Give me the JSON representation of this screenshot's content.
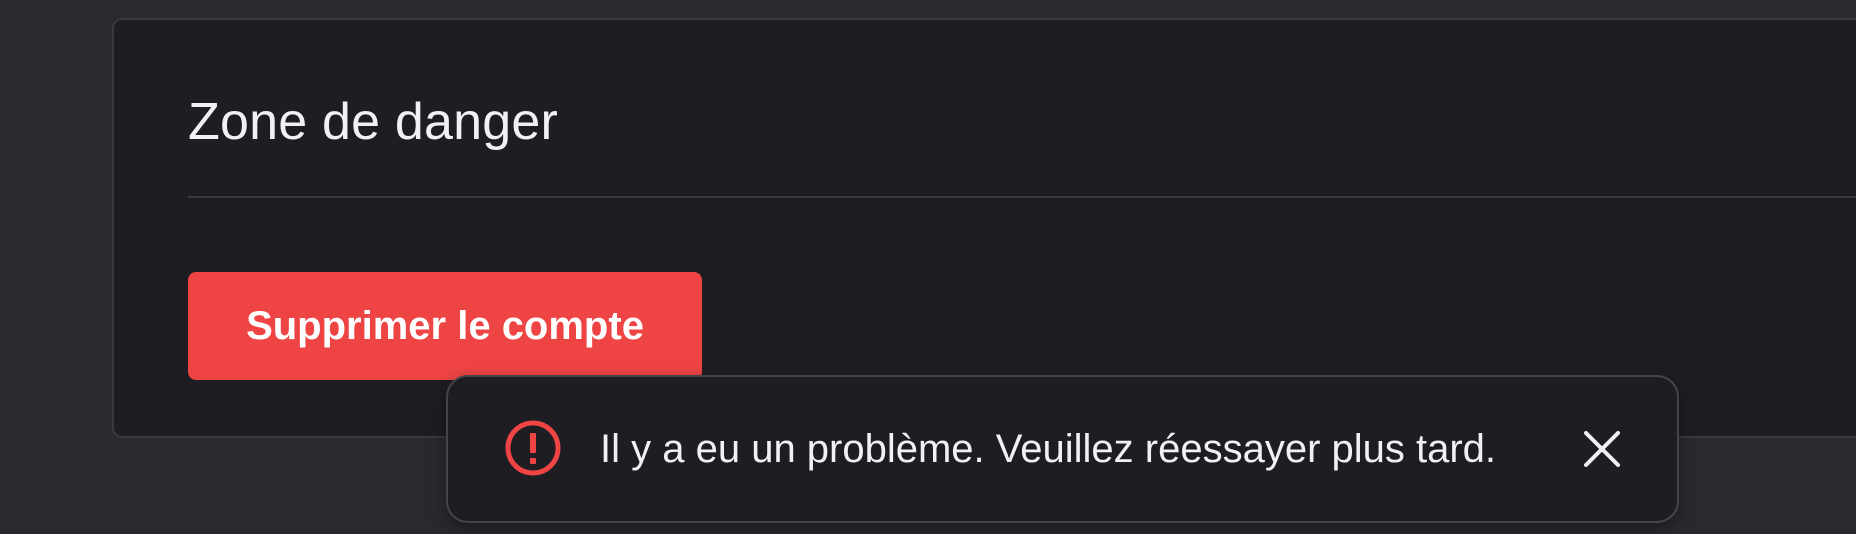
{
  "danger_zone": {
    "title": "Zone de danger",
    "delete_button_label": "Supprimer le compte"
  },
  "toast": {
    "message": "Il y a eu un problème. Veuillez réessayer plus tard.",
    "icon": "alert-circle-icon",
    "close_icon": "close-icon"
  },
  "colors": {
    "page_background": "#2a292e",
    "card_background": "#1e1d22",
    "border": "#3a393f",
    "danger": "#ef4444",
    "text": "#f1f1f3"
  }
}
